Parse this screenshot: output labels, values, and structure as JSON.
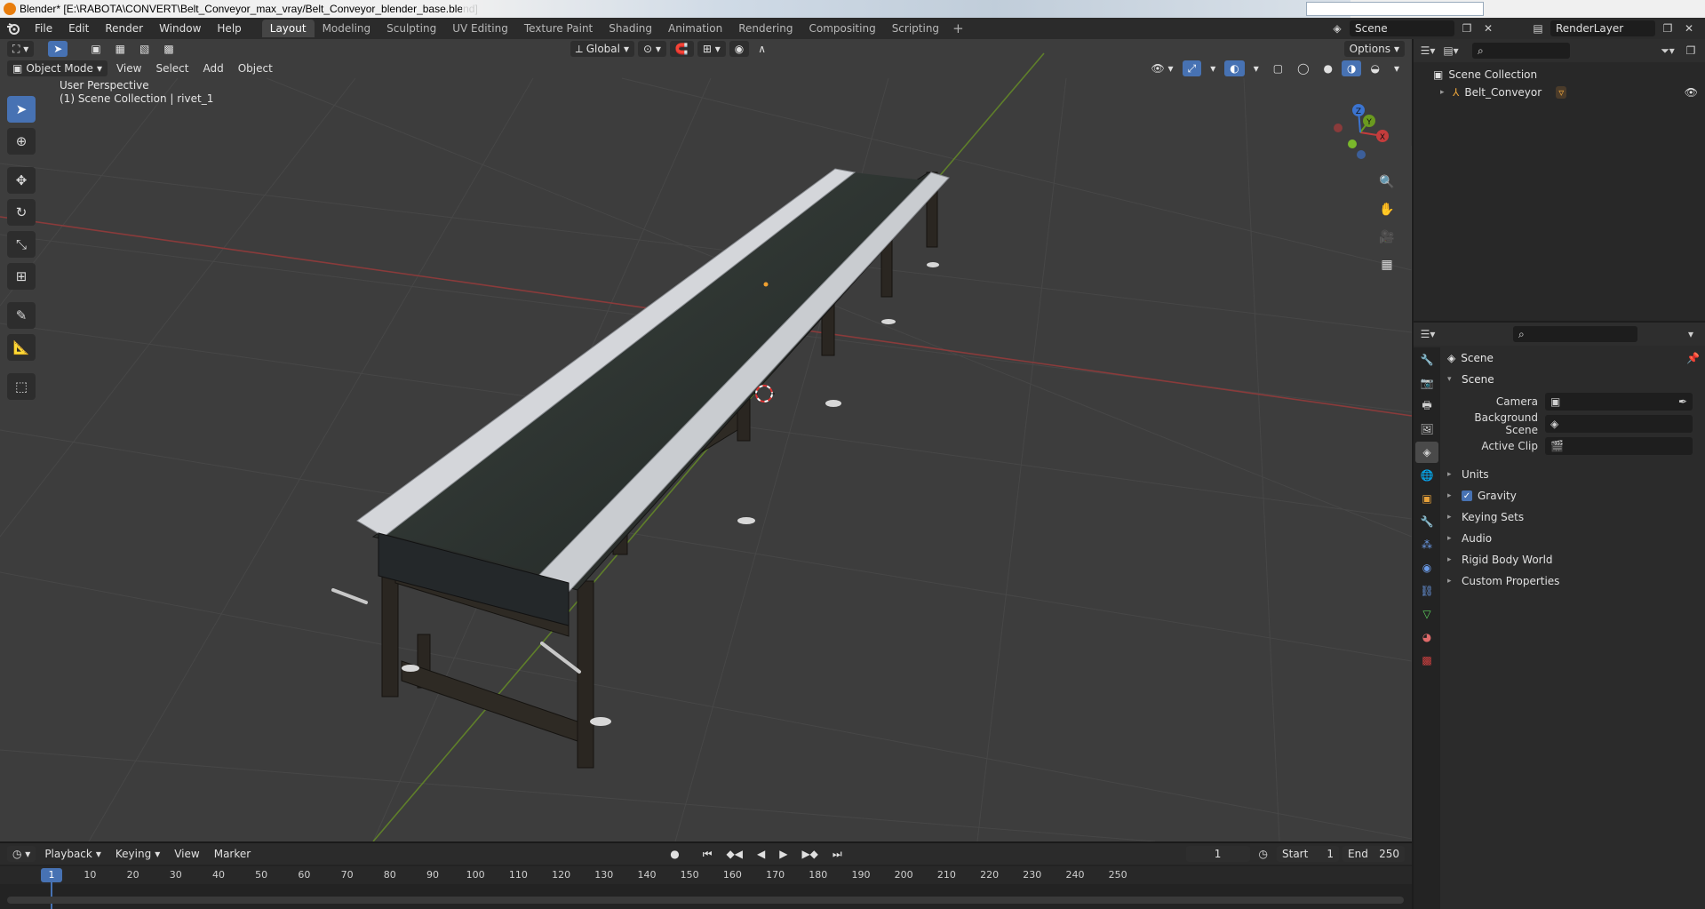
{
  "window": {
    "title": "Blender* [E:\\RABOTA\\CONVERT\\Belt_Conveyor_max_vray/Belt_Conveyor_blender_base.blend]"
  },
  "menubar": {
    "menus": [
      "File",
      "Edit",
      "Render",
      "Window",
      "Help"
    ],
    "workspace_tabs": [
      "Layout",
      "Modeling",
      "Sculpting",
      "UV Editing",
      "Texture Paint",
      "Shading",
      "Animation",
      "Rendering",
      "Compositing",
      "Scripting"
    ],
    "active_tab": "Layout",
    "scene": "Scene",
    "render_layer": "RenderLayer"
  },
  "viewport": {
    "transform_orientation": "Global",
    "options_label": "Options",
    "mode": "Object Mode",
    "menus": [
      "View",
      "Select",
      "Add",
      "Object"
    ],
    "overlay_line1": "User Perspective",
    "overlay_line2": "(1) Scene Collection | rivet_1",
    "axis_labels": {
      "x": "X",
      "y": "Y",
      "z": "Z"
    }
  },
  "outliner": {
    "root": "Scene Collection",
    "items": [
      {
        "name": "Belt_Conveyor"
      }
    ]
  },
  "properties": {
    "context": "Scene",
    "panel": "Scene",
    "fields": [
      {
        "label": "Camera",
        "value": ""
      },
      {
        "label": "Background Scene",
        "value": ""
      },
      {
        "label": "Active Clip",
        "value": ""
      }
    ],
    "subpanels": [
      "Units",
      "Gravity",
      "Keying Sets",
      "Audio",
      "Rigid Body World",
      "Custom Properties"
    ],
    "gravity_checked": true
  },
  "timeline": {
    "menus": [
      "Playback",
      "Keying",
      "View",
      "Marker"
    ],
    "current_frame": "1",
    "start_label": "Start",
    "start": "1",
    "end_label": "End",
    "end": "250",
    "ruler_ticks": [
      "1",
      "10",
      "20",
      "30",
      "40",
      "50",
      "60",
      "70",
      "80",
      "90",
      "100",
      "110",
      "120",
      "130",
      "140",
      "150",
      "160",
      "170",
      "180",
      "190",
      "200",
      "210",
      "220",
      "230",
      "240",
      "250"
    ]
  },
  "colors": {
    "accent": "#4772b3",
    "x_axis": "#c43c3c",
    "y_axis": "#6a9a1f",
    "z_axis": "#3b74d1",
    "viewport_bg": "#3d3d3d",
    "grid": "#474747"
  }
}
